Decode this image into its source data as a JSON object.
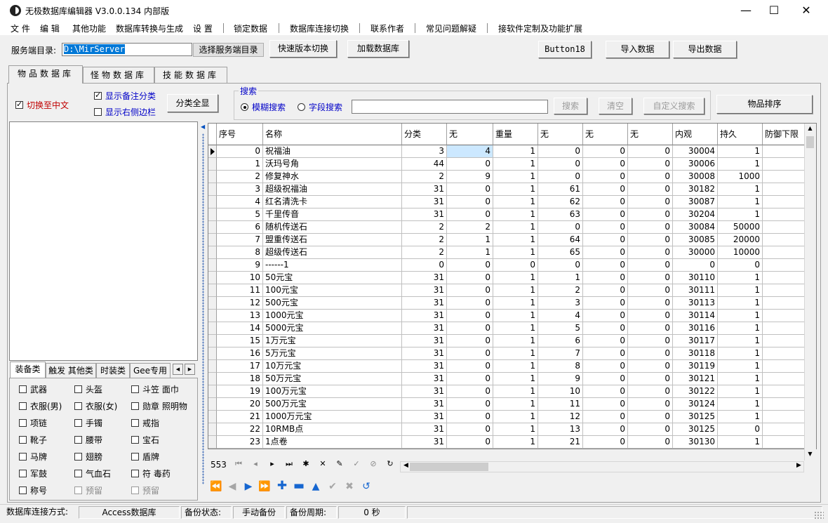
{
  "window": {
    "title": "无极数据库编辑器 V3.0.0.134 内部版",
    "minimize": "—",
    "maximize": "☐",
    "close": "✕"
  },
  "menu": [
    "文 件",
    "编 辑",
    "其他功能",
    "数据库转换与生成",
    "设 置",
    "锁定数据",
    "数据库连接切换",
    "联系作者",
    "常见问题解疑",
    "接软件定制及功能扩展"
  ],
  "toolbar": {
    "server_label": "服务端目录:",
    "server_path": "D:\\MirServer",
    "select_dir": "选择服务端目录",
    "quick_switch": "快速版本切换",
    "load_db": "加载数据库",
    "button18": "Button18",
    "import": "导入数据",
    "export": "导出数据"
  },
  "tabs": [
    "物品数据库",
    "怪物数据库",
    "技能数据库"
  ],
  "options": {
    "to_chinese": "切换至中文",
    "show_remark": "显示备注分类",
    "show_sidebar": "显示右侧边栏",
    "show_all": "分类全显"
  },
  "search": {
    "group_label": "搜索",
    "fuzzy": "模糊搜索",
    "field": "字段搜索",
    "value": "",
    "search_btn": "搜索",
    "clear_btn": "清空",
    "custom_btn": "自定义搜索",
    "sort_btn": "物品排序"
  },
  "category_tabs": [
    "装备类",
    "触发 其他类",
    "时装类",
    "Gee专用"
  ],
  "categories": [
    [
      "武器",
      "头盔",
      "斗笠 面巾"
    ],
    [
      "衣服(男)",
      "衣服(女)",
      "勋章 照明物"
    ],
    [
      "项链",
      "手镯",
      "戒指"
    ],
    [
      "靴子",
      "腰带",
      "宝石"
    ],
    [
      "马牌",
      "翅膀",
      "盾牌"
    ],
    [
      "军鼓",
      "气血石",
      "符 毒药"
    ],
    [
      "称号",
      "预留",
      "预留"
    ]
  ],
  "grid": {
    "columns": [
      "序号",
      "名称",
      "分类",
      "无",
      "重量",
      "无",
      "无",
      "无",
      "内观",
      "持久",
      "防御下限"
    ],
    "rows": [
      [
        0,
        "祝福油",
        3,
        4,
        1,
        0,
        0,
        0,
        30004,
        1
      ],
      [
        1,
        "沃玛号角",
        44,
        0,
        1,
        0,
        0,
        0,
        30006,
        1
      ],
      [
        2,
        "修复神水",
        2,
        9,
        1,
        0,
        0,
        0,
        30008,
        1000
      ],
      [
        3,
        "超级祝福油",
        31,
        0,
        1,
        61,
        0,
        0,
        30182,
        1
      ],
      [
        4,
        "红名清洗卡",
        31,
        0,
        1,
        62,
        0,
        0,
        30087,
        1
      ],
      [
        5,
        "千里传音",
        31,
        0,
        1,
        63,
        0,
        0,
        30204,
        1
      ],
      [
        6,
        "随机传送石",
        2,
        2,
        1,
        0,
        0,
        0,
        30084,
        50000
      ],
      [
        7,
        "盟重传送石",
        2,
        1,
        1,
        64,
        0,
        0,
        30085,
        20000
      ],
      [
        8,
        "超级传送石",
        2,
        1,
        1,
        65,
        0,
        0,
        30000,
        10000
      ],
      [
        9,
        "------1",
        0,
        0,
        0,
        0,
        0,
        0,
        0,
        0
      ],
      [
        10,
        "50元宝",
        31,
        0,
        1,
        1,
        0,
        0,
        30110,
        1
      ],
      [
        11,
        "100元宝",
        31,
        0,
        1,
        2,
        0,
        0,
        30111,
        1
      ],
      [
        12,
        "500元宝",
        31,
        0,
        1,
        3,
        0,
        0,
        30113,
        1
      ],
      [
        13,
        "1000元宝",
        31,
        0,
        1,
        4,
        0,
        0,
        30114,
        1
      ],
      [
        14,
        "5000元宝",
        31,
        0,
        1,
        5,
        0,
        0,
        30116,
        1
      ],
      [
        15,
        "1万元宝",
        31,
        0,
        1,
        6,
        0,
        0,
        30117,
        1
      ],
      [
        16,
        "5万元宝",
        31,
        0,
        1,
        7,
        0,
        0,
        30118,
        1
      ],
      [
        17,
        "10万元宝",
        31,
        0,
        1,
        8,
        0,
        0,
        30119,
        1
      ],
      [
        18,
        "50万元宝",
        31,
        0,
        1,
        9,
        0,
        0,
        30121,
        1
      ],
      [
        19,
        "100万元宝",
        31,
        0,
        1,
        10,
        0,
        0,
        30122,
        1
      ],
      [
        20,
        "500万元宝",
        31,
        0,
        1,
        11,
        0,
        0,
        30124,
        1
      ],
      [
        21,
        "1000万元宝",
        31,
        0,
        1,
        12,
        0,
        0,
        30125,
        1
      ],
      [
        22,
        "10RMB点",
        31,
        0,
        1,
        13,
        0,
        0,
        30125,
        0
      ],
      [
        23,
        "1点卷",
        31,
        0,
        1,
        21,
        0,
        0,
        30130,
        1
      ]
    ],
    "record_count": "553"
  },
  "status": {
    "conn_label": "数据库连接方式:",
    "conn_value": "Access数据库",
    "backup_label": "备份状态:",
    "backup_value": "手动备份",
    "period_label": "备份周期:",
    "period_value": "0 秒"
  }
}
